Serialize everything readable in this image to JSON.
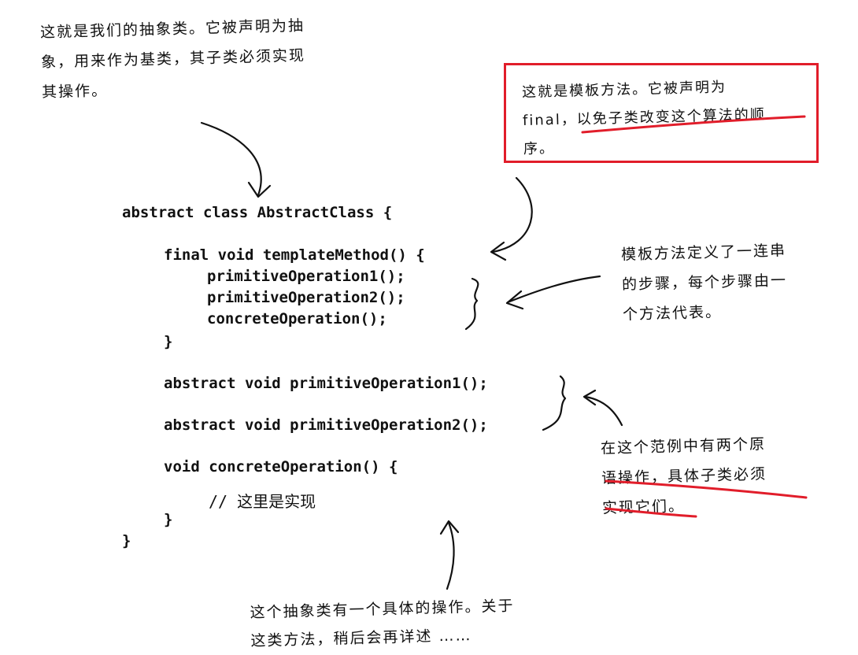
{
  "notes": {
    "abstract_class": {
      "lines": [
        "这就是我们的抽象类。它被声明为抽",
        "象，用来作为基类，其子类必须实现",
        "其操作。"
      ]
    },
    "template_method": {
      "lines": [
        "这就是模板方法。它被声明为",
        "final，以免子类改变这个算法的顺",
        "序。"
      ]
    },
    "steps": {
      "lines": [
        "模板方法定义了一连串",
        "的步骤，每个步骤由一",
        "个方法代表。"
      ]
    },
    "primitive_ops": {
      "lines": [
        "在这个范例中有两个原",
        "语操作，具体子类必须",
        "实现它们。"
      ]
    },
    "concrete_op": {
      "lines": [
        "这个抽象类有一个具体的操作。关于",
        "这类方法，稍后会再详述 ……"
      ]
    }
  },
  "code": {
    "class_decl": "abstract class AbstractClass {",
    "template_decl": "final void templateMethod() {",
    "call1": "primitiveOperation1();",
    "call2": "primitiveOperation2();",
    "call3": "concreteOperation();",
    "close_inner": "}",
    "abstract1": "abstract void primitiveOperation1();",
    "abstract2": "abstract void primitiveOperation2();",
    "concrete_decl": "void concreteOperation() {",
    "comment_slashes": "//",
    "comment_text": "这里是实现",
    "close_inner2": "}",
    "close_class": "}"
  },
  "colors": {
    "highlight": "#e11d2a",
    "ink": "#111111"
  }
}
